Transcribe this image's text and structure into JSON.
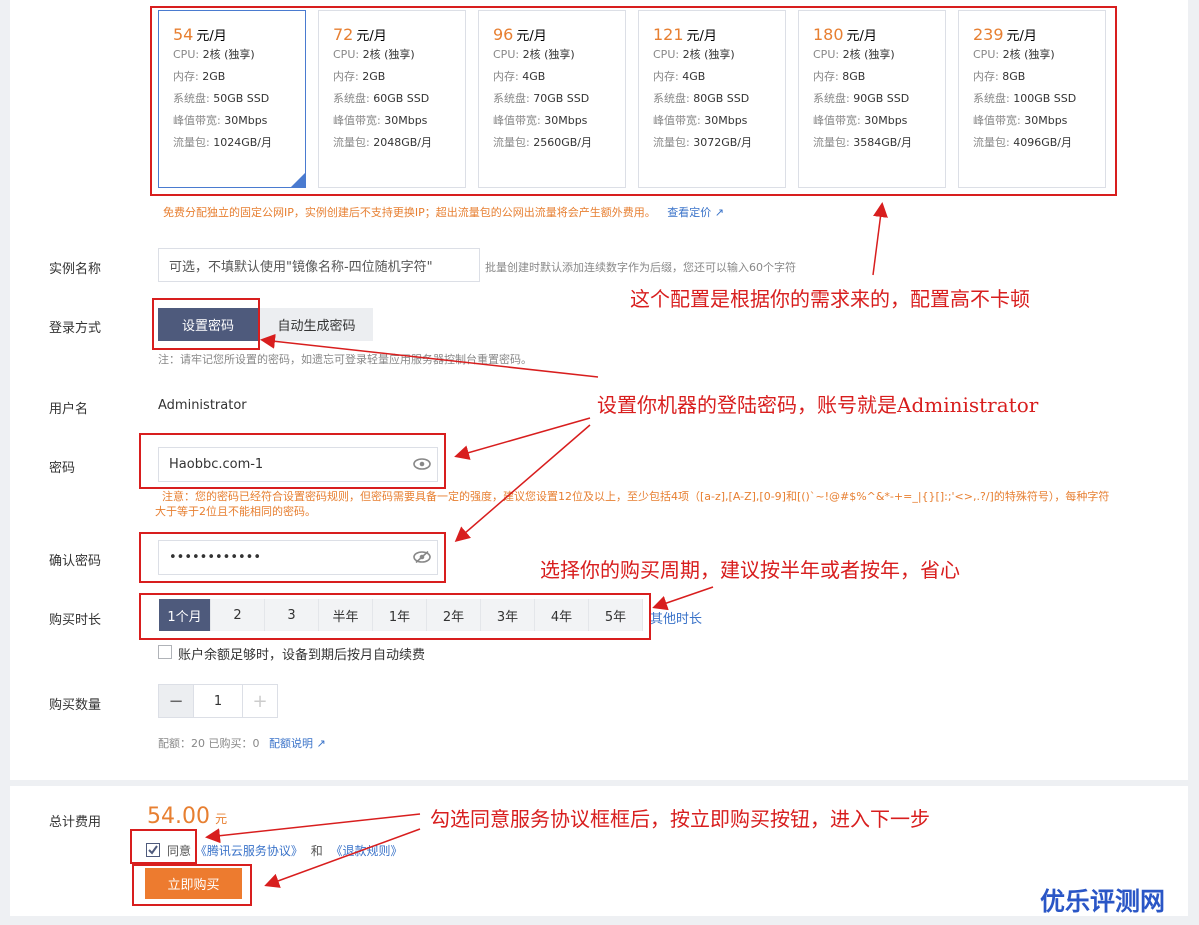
{
  "plans": [
    {
      "price": "54",
      "unit": "元/月",
      "cpu": "2核 (独享)",
      "mem": "2GB",
      "disk": "50GB SSD",
      "bw": "30Mbps",
      "traffic": "1024GB/月"
    },
    {
      "price": "72",
      "unit": "元/月",
      "cpu": "2核 (独享)",
      "mem": "2GB",
      "disk": "60GB SSD",
      "bw": "30Mbps",
      "traffic": "2048GB/月"
    },
    {
      "price": "96",
      "unit": "元/月",
      "cpu": "2核 (独享)",
      "mem": "4GB",
      "disk": "70GB SSD",
      "bw": "30Mbps",
      "traffic": "2560GB/月"
    },
    {
      "price": "121",
      "unit": "元/月",
      "cpu": "2核 (独享)",
      "mem": "4GB",
      "disk": "80GB SSD",
      "bw": "30Mbps",
      "traffic": "3072GB/月"
    },
    {
      "price": "180",
      "unit": "元/月",
      "cpu": "2核 (独享)",
      "mem": "8GB",
      "disk": "90GB SSD",
      "bw": "30Mbps",
      "traffic": "3584GB/月"
    },
    {
      "price": "239",
      "unit": "元/月",
      "cpu": "2核 (独享)",
      "mem": "8GB",
      "disk": "100GB SSD",
      "bw": "30Mbps",
      "traffic": "4096GB/月"
    }
  ],
  "spec_labels": {
    "cpu": "CPU:",
    "mem": "内存:",
    "disk": "系统盘:",
    "bw": "峰值带宽:",
    "traffic": "流量包:"
  },
  "plan_note": "免费分配独立的固定公网IP，实例创建后不支持更换IP；超出流量包的公网出流量将会产生额外费用。",
  "plan_note_link": "查看定价",
  "instance_name": {
    "label": "实例名称",
    "placeholder": "可选，不填默认使用\"镜像名称-四位随机字符\"",
    "hint": "批量创建时默认添加连续数字作为后缀，您还可以输入60个字符"
  },
  "login": {
    "label": "登录方式",
    "opt_set": "设置密码",
    "opt_auto": "自动生成密码",
    "hint": "注：请牢记您所设置的密码，如遗忘可登录轻量应用服务器控制台重置密码。"
  },
  "username": {
    "label": "用户名",
    "value": "Administrator"
  },
  "password": {
    "label": "密码",
    "value": "Haobbc.com-1",
    "note1": "注意：您的密码已经符合设置密码规则，但密码需要具备一定的强度，建议您设置12位及以上，至少包括4项（[a-z],[A-Z],[0-9]和[()`~!@#$%^&*-+=_|{}[]:;'<>,.?/]的特殊符号），每种字符",
    "note2": "大于等于2位且不能相同的密码。"
  },
  "confirm": {
    "label": "确认密码",
    "value": "••••••••••••"
  },
  "duration": {
    "label": "购买时长",
    "options": [
      "1个月",
      "2",
      "3",
      "半年",
      "1年",
      "2年",
      "3年",
      "4年",
      "5年"
    ],
    "other": "其他时长",
    "autorenew": "账户余额足够时，设备到期后按月自动续费"
  },
  "quantity": {
    "label": "购买数量",
    "minus": "−",
    "value": "1",
    "plus": "+",
    "quota": "配额：20 已购买：0",
    "quota_link": "配额说明"
  },
  "total": {
    "label": "总计费用",
    "amount": "54.00",
    "unit": "元"
  },
  "agree": {
    "text": "同意",
    "doc1": "《腾讯云服务协议》",
    "and": "和",
    "doc2": "《退款规则》"
  },
  "buy_button": "立即购买",
  "annotations": {
    "a1": "这个配置是根据你的需求来的，配置高不卡顿",
    "a2": "设置你机器的登陆密码，账号就是Administrator",
    "a3": "选择你的购买周期，建议按半年或者按年，省心",
    "a4": "勾选同意服务协议框框后，按立即购买按钮，进入下一步"
  },
  "watermark": "优乐评测网",
  "colors": {
    "accent": "#e77f31",
    "annotation": "#d81e1e",
    "selected": "#4e5a7c",
    "link": "#3a73c9"
  }
}
